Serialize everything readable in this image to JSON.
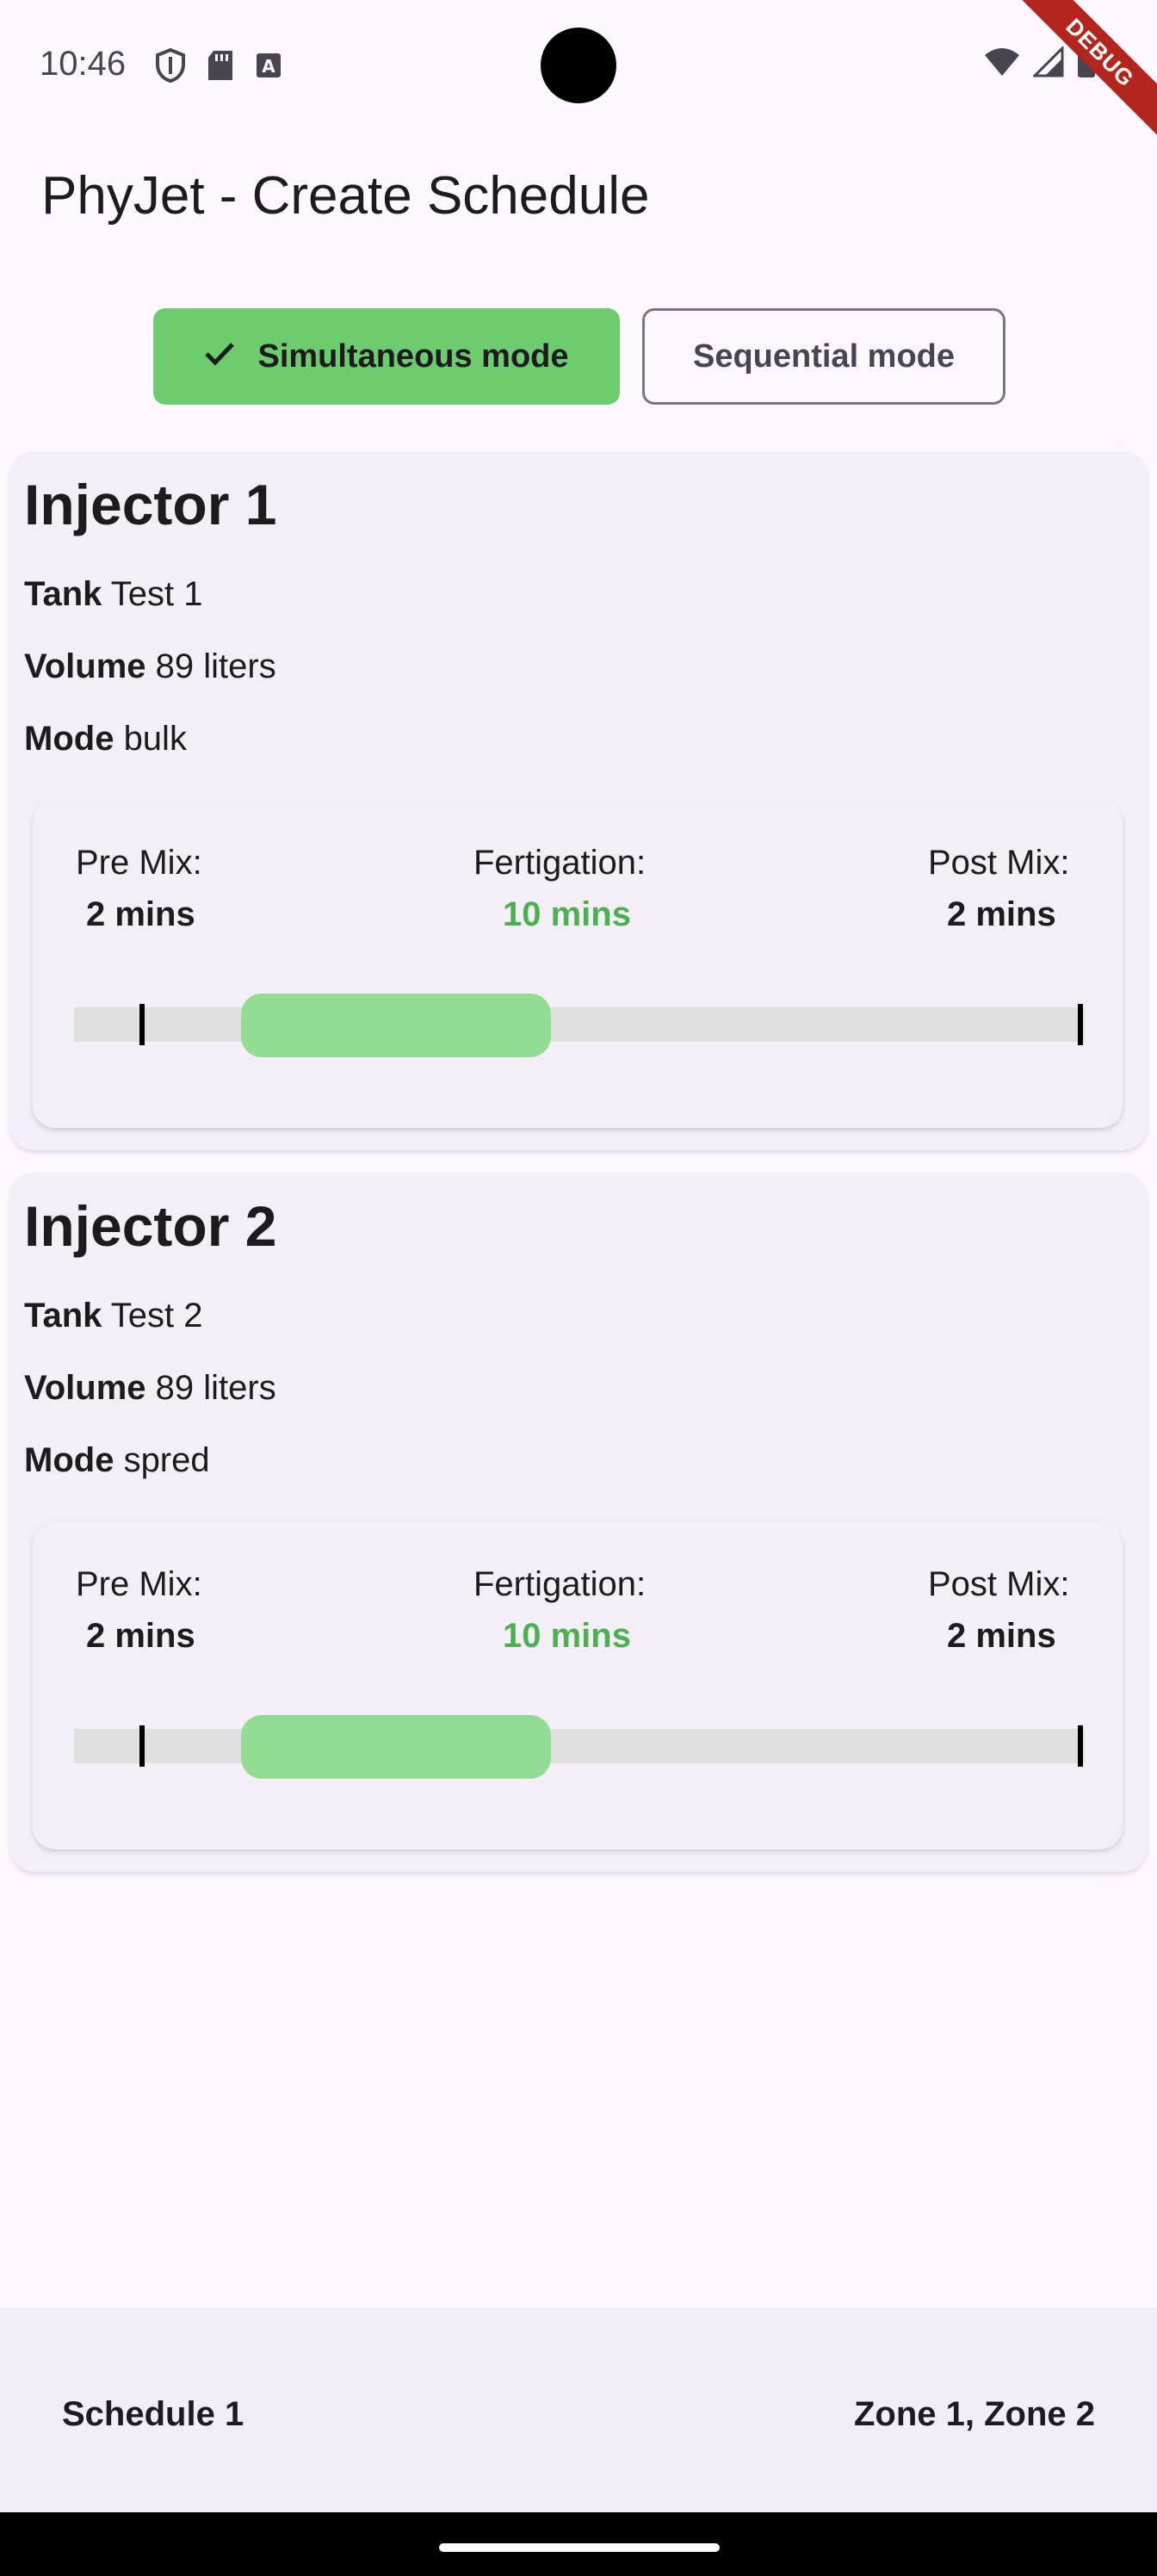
{
  "status_bar": {
    "time": "10:46",
    "left_icons": [
      "shield-icon",
      "sd-card-icon",
      "text-a-icon"
    ],
    "right_icons": [
      "wifi-icon",
      "cellular-signal-icon",
      "battery-icon"
    ],
    "debug_banner": "DEBUG"
  },
  "app_title": "PhyJet - Create Schedule",
  "mode_toggle": {
    "options": [
      {
        "label": "Simultaneous mode",
        "selected": true
      },
      {
        "label": "Sequential mode",
        "selected": false
      }
    ]
  },
  "injectors": [
    {
      "title": "Injector 1",
      "tank_label": "Tank",
      "tank_value": "Test 1",
      "volume_label": "Volume",
      "volume_value": "89 liters",
      "mode_label": "Mode",
      "mode_value": "bulk",
      "timing": {
        "pre_mix_label": "Pre Mix:",
        "pre_mix_value": "2 mins",
        "fertigation_label": "Fertigation:",
        "fertigation_value": "10 mins",
        "post_mix_label": "Post Mix:",
        "post_mix_value": "2 mins"
      }
    },
    {
      "title": "Injector 2",
      "tank_label": "Tank",
      "tank_value": "Test 2",
      "volume_label": "Volume",
      "volume_value": "89 liters",
      "mode_label": "Mode",
      "mode_value": "spred",
      "timing": {
        "pre_mix_label": "Pre Mix:",
        "pre_mix_value": "2 mins",
        "fertigation_label": "Fertigation:",
        "fertigation_value": "10 mins",
        "post_mix_label": "Post Mix:",
        "post_mix_value": "2 mins"
      }
    }
  ],
  "bottom_bar": {
    "schedule_name": "Schedule 1",
    "zones": "Zone 1, Zone 2"
  },
  "colors": {
    "accent_green": "#6ccc6e",
    "fertigation_text": "#4caf50",
    "pill_green": "#93dc94",
    "background": "#fef7ff"
  }
}
